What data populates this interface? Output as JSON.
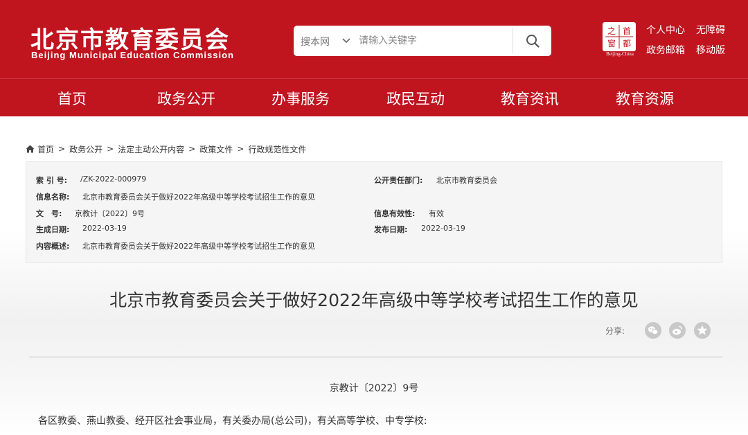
{
  "header": {
    "logo_cn": "北京市教育委员会",
    "logo_en": "Beijing Municipal Education Commission",
    "seal": {
      "chars": [
        "之",
        "首",
        "窗",
        "都"
      ],
      "caption": "Beijing-China"
    },
    "links": {
      "personal_center": "个人中心",
      "accessibility": "无障碍",
      "gov_mail": "政务邮箱",
      "mobile": "移动版"
    }
  },
  "search": {
    "scope": "搜本网",
    "placeholder": "请输入关键字"
  },
  "nav": {
    "items": [
      "首页",
      "政务公开",
      "办事服务",
      "政民互动",
      "教育资讯",
      "教育资源"
    ]
  },
  "breadcrumb": [
    "首页",
    "政务公开",
    "法定主动公开内容",
    "政策文件",
    "行政规范性文件"
  ],
  "info": {
    "index_label": "索 引 号:",
    "index_value": "/ZK-2022-000979",
    "dept_label": "公开责任部门:",
    "dept_value": "北京市教育委员会",
    "name_label": "信息名称:",
    "name_value": "北京市教育委员会关于做好2022年高级中等学校考试招生工作的意见",
    "docno_label": "文　号:",
    "docno_value": "京教计〔2022〕9号",
    "validity_label": "信息有效性:",
    "validity_value": "有效",
    "created_label": "生成日期:",
    "created_value": "2022-03-19",
    "published_label": "发布日期:",
    "published_value": "2022-03-19",
    "summary_label": "内容概述:",
    "summary_value": "北京市教育委员会关于做好2022年高级中等学校考试招生工作的意见"
  },
  "article": {
    "title": "北京市教育委员会关于做好2022年高级中等学校考试招生工作的意见",
    "share_label": "分享:",
    "share_icons": [
      "wechat-icon",
      "weibo-icon",
      "favorite-icon"
    ],
    "doc_number": "京教计〔2022〕9号",
    "recipients": "各区教委、燕山教委、经开区社会事业局，有关委办局(总公司)，有关高等学校、中专学校:"
  },
  "colors": {
    "brand_red": "#c0141f",
    "info_bg": "#f5f5f5",
    "share_icon": "#c8c8c8"
  }
}
